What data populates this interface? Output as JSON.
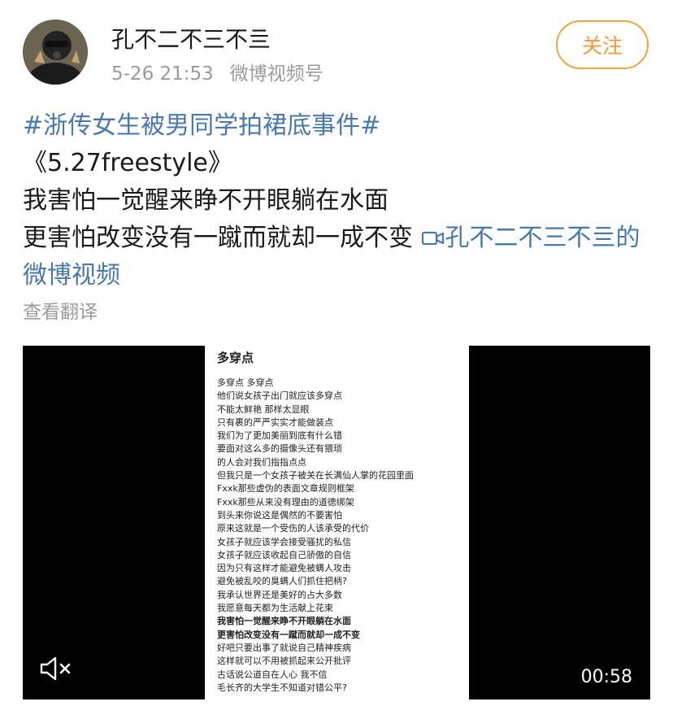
{
  "header": {
    "username": "孔不二不三不亖",
    "timestamp": "5-26 21:53",
    "source": "微博视频号",
    "follow_label": "关注"
  },
  "post": {
    "hashtag": "#浙传女生被男同学拍裙底事件#",
    "lines": [
      "《5.27freestyle》",
      "我害怕一觉醒来睁不开眼躺在水面",
      "更害怕改变没有一蹴而就却一成不变 "
    ],
    "video_link": "孔不二不三不亖的微博视频",
    "translate_label": "查看翻译"
  },
  "video": {
    "lyric_title": "多穿点",
    "lyrics": [
      "多穿点 多穿点",
      "他们说女孩子出门就应该多穿点",
      "不能太鲜艳 那样太显眼",
      "只有裹的严严实实才能做装点",
      "我们为了更加美丽到底有什么错",
      "要面对这么多的摄像头还有猥琐",
      "的人会对我们指指点点",
      "但我只是一个女孩子被关在长满仙人掌的花园里面",
      "Fxxk那些虚伪的表面文章规则框架",
      "Fxxk那些从来没有理由的道德绑架",
      "到头来你说这是偶然的不要害怕",
      "原来这就是一个受伤的人该承受的代价",
      "女孩子就应该学会接受骚扰的私信",
      "女孩子就应该收起自己骄傲的自信",
      "因为只有这样才能避免被螨人攻击",
      "避免被乱咬的臭螨人们抓住把柄?",
      "我承认世界还是美好的占大多数",
      "我愿意每天都为生活献上花束",
      "我害怕一觉醒来睁不开眼躺在水面",
      "更害怕改变没有一蹴而就却一成不变",
      "好吧只要出事了就说自己精神疾病",
      "这样就可以不用被抓起来公开批评",
      "古话说公道自在人心 我不信",
      "毛长齐的大学生不知道对错公平?"
    ],
    "bold_lines": [
      18,
      19
    ],
    "duration": "00:58",
    "mute_icon": "speaker-muted-icon"
  },
  "colors": {
    "link": "#4a78aa",
    "follow": "#f29a38",
    "meta": "#9b9b9b"
  }
}
